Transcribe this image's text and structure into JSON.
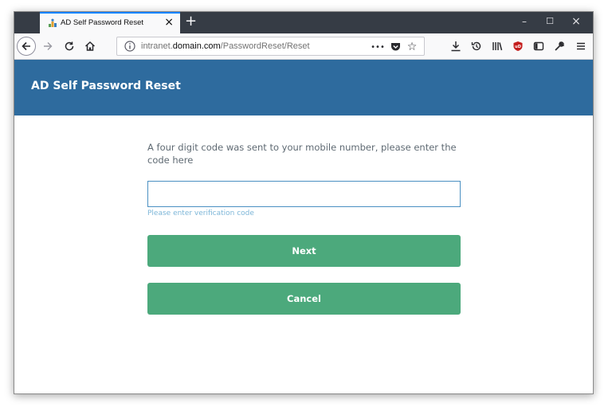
{
  "browser": {
    "tab": {
      "title": "AD Self Password Reset",
      "favicon": "site-favicon-icon",
      "close_glyph": "×"
    },
    "new_tab_glyph": "+",
    "window_controls": {
      "minimize": "–",
      "maximize": "☐",
      "close": "×"
    },
    "url": {
      "prefix": "intranet.",
      "host": "domain.com",
      "path": "/PasswordReset/Reset"
    },
    "page_actions": {
      "more": "•••"
    },
    "colors": {
      "tabstrip": "#363c45",
      "active_tab_accent": "#0a84ff"
    }
  },
  "header": {
    "title": "AD Self Password Reset",
    "color": "#2e6b9e"
  },
  "form": {
    "instruction": "A four digit code was sent to your mobile number, please enter the code here",
    "code_value": "",
    "code_placeholder": "",
    "hint": "Please enter verification code",
    "next_label": "Next",
    "cancel_label": "Cancel",
    "button_color": "#4ca97c"
  }
}
